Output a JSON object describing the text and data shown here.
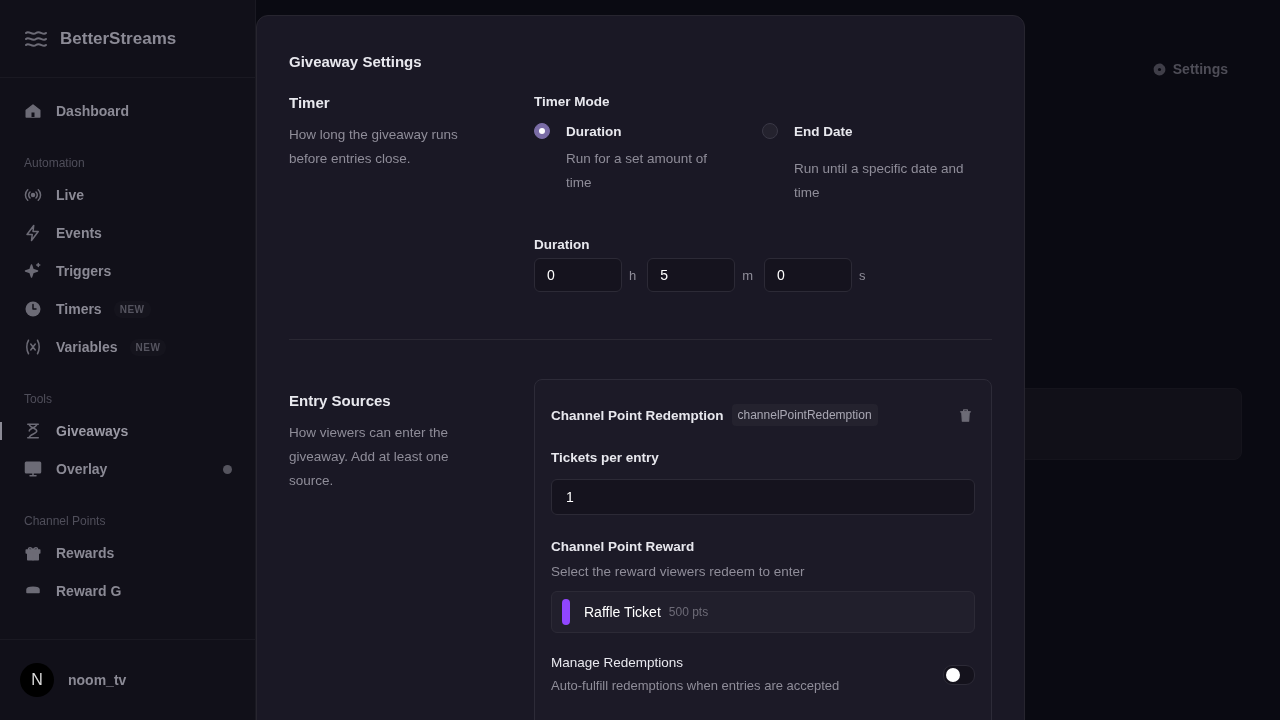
{
  "app": {
    "name": "BetterStreams"
  },
  "sidebar": {
    "sections": [
      {
        "items": [
          {
            "label": "Dashboard",
            "selected": false
          }
        ]
      },
      {
        "title": "Automation",
        "items": [
          {
            "label": "Live",
            "selected": false
          },
          {
            "label": "Events",
            "selected": false
          },
          {
            "label": "Triggers",
            "selected": false
          },
          {
            "label": "Timers",
            "badge": "NEW",
            "selected": false
          },
          {
            "label": "Variables",
            "badge": "NEW",
            "selected": false
          }
        ]
      },
      {
        "title": "Tools",
        "items": [
          {
            "label": "Giveaways",
            "selected": true
          },
          {
            "label": "Overlay",
            "status_dot": true,
            "selected": false
          }
        ]
      },
      {
        "title": "Channel Points",
        "items": [
          {
            "label": "Rewards",
            "selected": false
          },
          {
            "label": "Reward G",
            "selected": false
          }
        ]
      }
    ],
    "user": {
      "initial": "N",
      "name": "noom_tv"
    }
  },
  "header": {
    "settings_link": "Settings"
  },
  "modal": {
    "title": "Giveaway Settings",
    "timer": {
      "title": "Timer",
      "description": "How long the giveaway runs before entries close.",
      "mode_label": "Timer Mode",
      "modes": [
        {
          "label": "Duration",
          "description": "Run for a set amount of time",
          "selected": true
        },
        {
          "label": "End Date",
          "description": "Run until a specific date and time",
          "selected": false
        }
      ],
      "duration_label": "Duration",
      "duration_fields": [
        {
          "value": "0",
          "unit": "h"
        },
        {
          "value": "5",
          "unit": "m"
        },
        {
          "value": "0",
          "unit": "s"
        }
      ]
    },
    "entry_sources": {
      "title": "Entry Sources",
      "description": "How viewers can enter the giveaway. Add at least one source.",
      "sources": [
        {
          "title": "Channel Point Redemption",
          "tag": "channelPointRedemption",
          "tickets_label": "Tickets per entry",
          "tickets_value": "1",
          "reward_label": "Channel Point Reward",
          "reward_hint": "Select the reward viewers redeem to enter",
          "reward": {
            "name": "Raffle Ticket",
            "points": "500 pts",
            "color": "#9146ff"
          },
          "manage_label": "Manage Redemptions",
          "manage_description": "Auto-fulfill redemptions when entries are accepted",
          "manage_on": false
        }
      ]
    }
  }
}
